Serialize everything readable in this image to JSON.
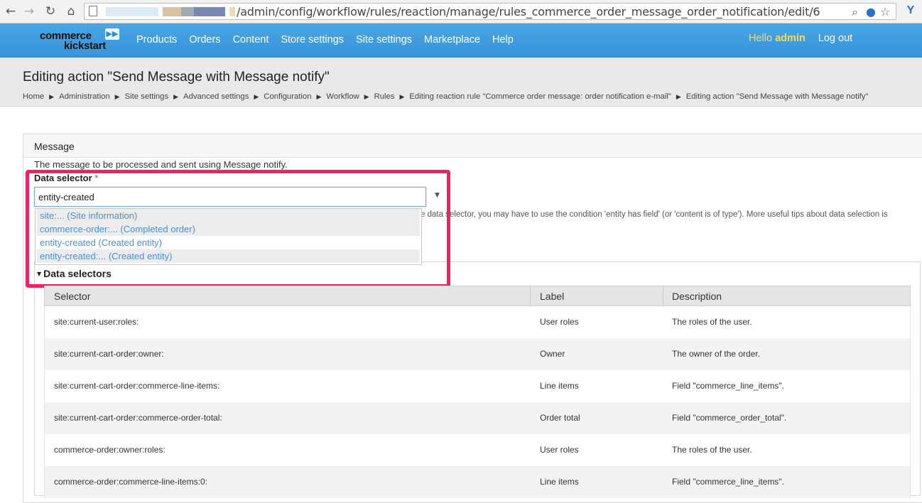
{
  "browser": {
    "url_path": "/admin/config/workflow/rules/reaction/manage/rules_commerce_order_message_order_notification/edit/6",
    "back_icon": "back-arrow-icon",
    "forward_icon": "forward-arrow-icon",
    "reload_icon": "reload-icon",
    "home_icon": "home-icon"
  },
  "header": {
    "logo_line1": "commerce",
    "logo_line2": "kickstart",
    "nav": [
      "Products",
      "Orders",
      "Content",
      "Store settings",
      "Site settings",
      "Marketplace",
      "Help"
    ],
    "hello_prefix": "Hello ",
    "username": "admin",
    "logout": "Log out",
    "brand_color": "#3f9de0"
  },
  "page": {
    "title": "Editing action \"Send Message with Message notify\"",
    "breadcrumb": [
      "Home",
      "Administration",
      "Site settings",
      "Advanced settings",
      "Configuration",
      "Workflow",
      "Rules",
      "Editing reaction rule \"Commerce order message: order notification e-mail\"",
      "Editing action \"Send Message with Message notify\""
    ]
  },
  "form": {
    "legend": "Message",
    "description": "The message to be processed and sent using Message notify.",
    "field_label": "Data selector",
    "required_mark": "*",
    "input_value": "entity-created",
    "help_text": "e data selector, you may have to use the condition 'entity has field' (or 'content is of type'). More useful tips about data selection is",
    "autocomplete": [
      "site:... (Site information)",
      "commerce-order:... (Completed order)",
      "entity-created (Created entity)",
      "entity-created:... (Created entity)"
    ],
    "collapsible_label": "Data selectors"
  },
  "table": {
    "headers": [
      "Selector",
      "Label",
      "Description"
    ],
    "rows": [
      [
        "site:current-user:roles:",
        "User roles",
        "The roles of the user."
      ],
      [
        "site:current-cart-order:owner:",
        "Owner",
        "The owner of the order."
      ],
      [
        "site:current-cart-order:commerce-line-items:",
        "Line items",
        "Field \"commerce_line_items\"."
      ],
      [
        "site:current-cart-order:commerce-order-total:",
        "Order total",
        "Field \"commerce_order_total\"."
      ],
      [
        "commerce-order:owner:roles:",
        "User roles",
        "The roles of the user."
      ],
      [
        "commerce-order:commerce-line-items:0:",
        "Line items",
        "Field \"commerce_line_items\"."
      ]
    ]
  }
}
